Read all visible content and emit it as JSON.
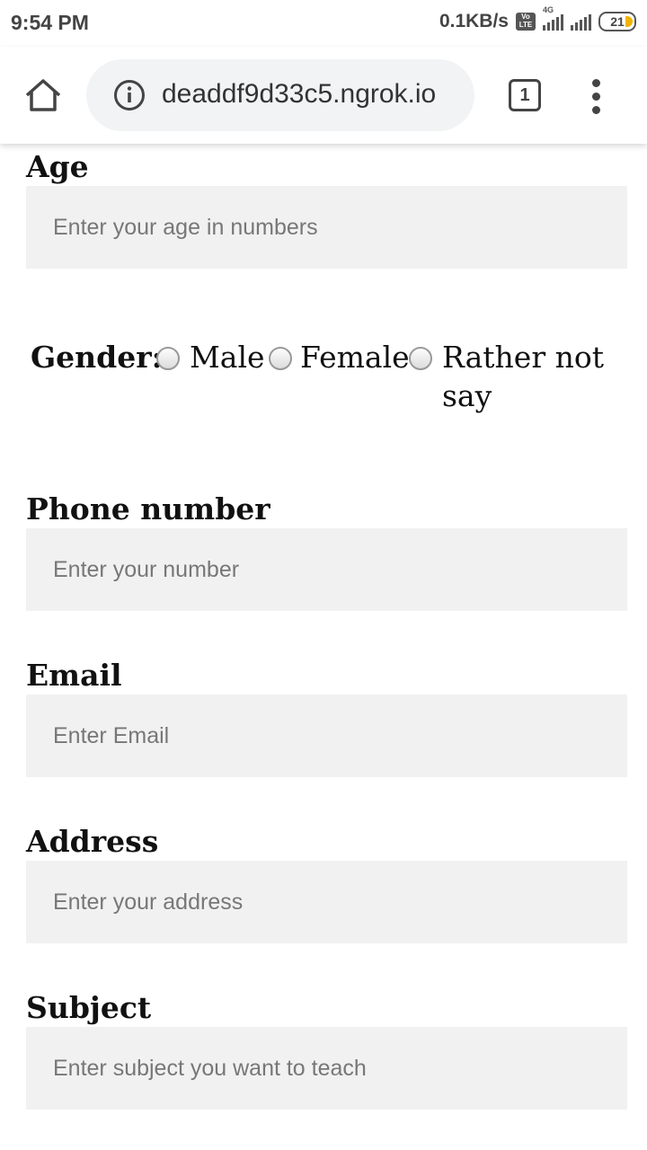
{
  "status_bar": {
    "time": "9:54 PM",
    "net_speed": "0.1KB/s",
    "volte": "Vo LTE",
    "network": "4G",
    "battery": "21"
  },
  "browser": {
    "url": "deaddf9d33c5.ngrok.io",
    "tab_count": "1"
  },
  "form": {
    "age": {
      "label": "Age",
      "placeholder": "Enter your age in numbers"
    },
    "gender": {
      "label": "Gender:",
      "options": [
        "Male",
        "Female",
        "Rather not",
        "say"
      ]
    },
    "phone": {
      "label": "Phone number",
      "placeholder": "Enter your number"
    },
    "email": {
      "label": "Email",
      "placeholder": "Enter Email"
    },
    "address": {
      "label": "Address",
      "placeholder": "Enter your address"
    },
    "subject": {
      "label": "Subject",
      "placeholder": "Enter subject you want to teach"
    }
  }
}
